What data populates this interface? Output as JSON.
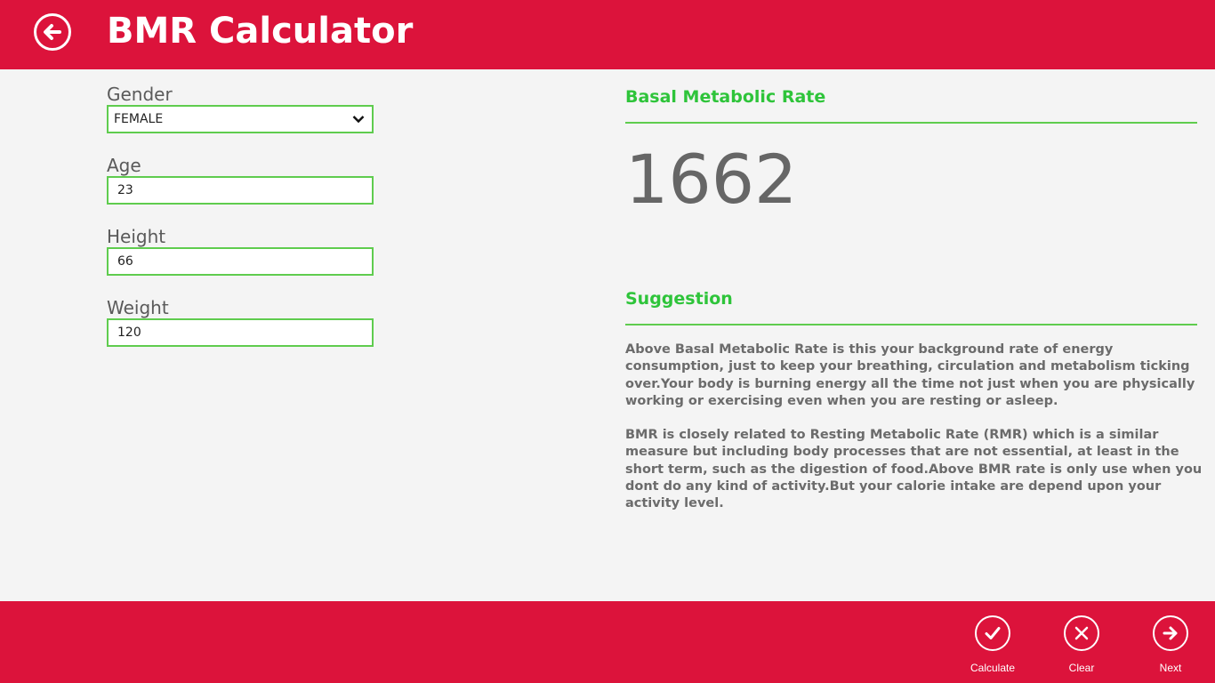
{
  "header": {
    "title": "BMR Calculator",
    "back_icon": "arrow-left-circle-icon"
  },
  "form": {
    "gender": {
      "label": "Gender",
      "value": "FEMALE"
    },
    "age": {
      "label": "Age",
      "value": "23"
    },
    "height": {
      "label": "Height",
      "value": "66"
    },
    "weight": {
      "label": "Weight",
      "value": "120"
    }
  },
  "result": {
    "title": "Basal Metabolic Rate",
    "value": "1662"
  },
  "suggestion": {
    "title": "Suggestion",
    "paragraphs": [
      "Above Basal Metabolic Rate is this your background rate of energy consumption, just to keep your breathing, circulation and metabolism ticking over.Your body is burning energy all the time not just when you are physically working or exercising even when you are resting or asleep.",
      "BMR is closely related to Resting Metabolic Rate (RMR) which is a similar measure but including body processes that are not essential, at least in the short term, such as the digestion of food.Above BMR rate is only use when you dont do any kind of activity.But your calorie intake are depend upon your activity level."
    ]
  },
  "appbar": {
    "calculate": {
      "label": "Calculate",
      "icon": "checkmark-icon"
    },
    "clear": {
      "label": "Clear",
      "icon": "clear-x-icon"
    },
    "next": {
      "label": "Next",
      "icon": "arrow-right-icon"
    }
  },
  "colors": {
    "brand": "#dc133b",
    "accent": "#5fcc4e",
    "heading": "#2ec43a",
    "background": "#f4f4f4"
  }
}
